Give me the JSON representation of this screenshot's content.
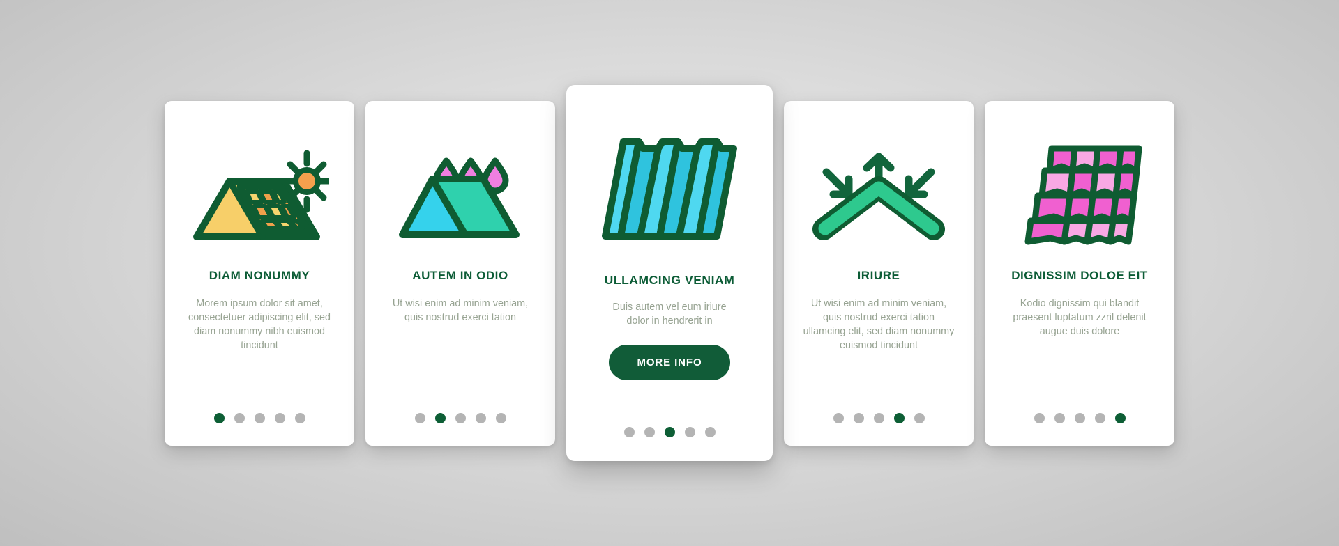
{
  "screen": {
    "name": "Roofing Onboarding Screens",
    "background_color": "#d9d9d9",
    "brand_green": "#0c5c36",
    "body_text_color": "#97a392",
    "dot_inactive_color": "#b4b4b4",
    "dot_active_color": "#0d5e35"
  },
  "cards": [
    {
      "icon": "solar-panel-roof-icon",
      "title": "DIAM NONUMMY",
      "body": "Morem ipsum dolor sit amet, consectetuer adipiscing elit, sed diam nonummy nibh euismod tincidunt",
      "dots_total": 5,
      "active_dot": 1,
      "featured": false,
      "cta_label": null
    },
    {
      "icon": "waterproof-roof-droplets-icon",
      "title": "AUTEM IN ODIO",
      "body": "Ut wisi enim ad minim veniam, quis nostrud exerci tation",
      "dots_total": 5,
      "active_dot": 2,
      "featured": false,
      "cta_label": null
    },
    {
      "icon": "corrugated-metal-sheet-icon",
      "title": "ULLAMCING VENIAM",
      "body": "Duis autem vel eum iriure dolor in hendrerit in",
      "dots_total": 5,
      "active_dot": 3,
      "featured": true,
      "cta_label": "MORE INFO"
    },
    {
      "icon": "roof-insulation-arrows-icon",
      "title": "IRIURE",
      "body": "Ut wisi enim ad minim veniam, quis nostrud exerci tation ullamcing elit, sed diam nonummy euismod tincidunt",
      "dots_total": 5,
      "active_dot": 4,
      "featured": false,
      "cta_label": null
    },
    {
      "icon": "clay-roof-tiles-icon",
      "title": "DIGNISSIM DOLOE EIT",
      "body": "Kodio dignissim qui blandit praesent luptatum zzril delenit augue duis dolore",
      "dots_total": 5,
      "active_dot": 5,
      "featured": false,
      "cta_label": null
    }
  ],
  "icon_colors": {
    "outline": "#0f5c32",
    "solar_roof_fill": "#f7cf69",
    "solar_cell_light": "#f5d46e",
    "solar_cell_dark": "#f0a04b",
    "sun_fill": "#f6a04d",
    "roof_cyan": "#35d2ec",
    "roof_teal": "#2fd1ad",
    "droplet_pink": "#f07fe0",
    "sheet_light": "#4fd8f0",
    "sheet_dark": "#2fc3de",
    "chevron_green": "#2ec98e",
    "tile_pink_dark": "#f060d0",
    "tile_pink_light": "#f8a8e4"
  }
}
